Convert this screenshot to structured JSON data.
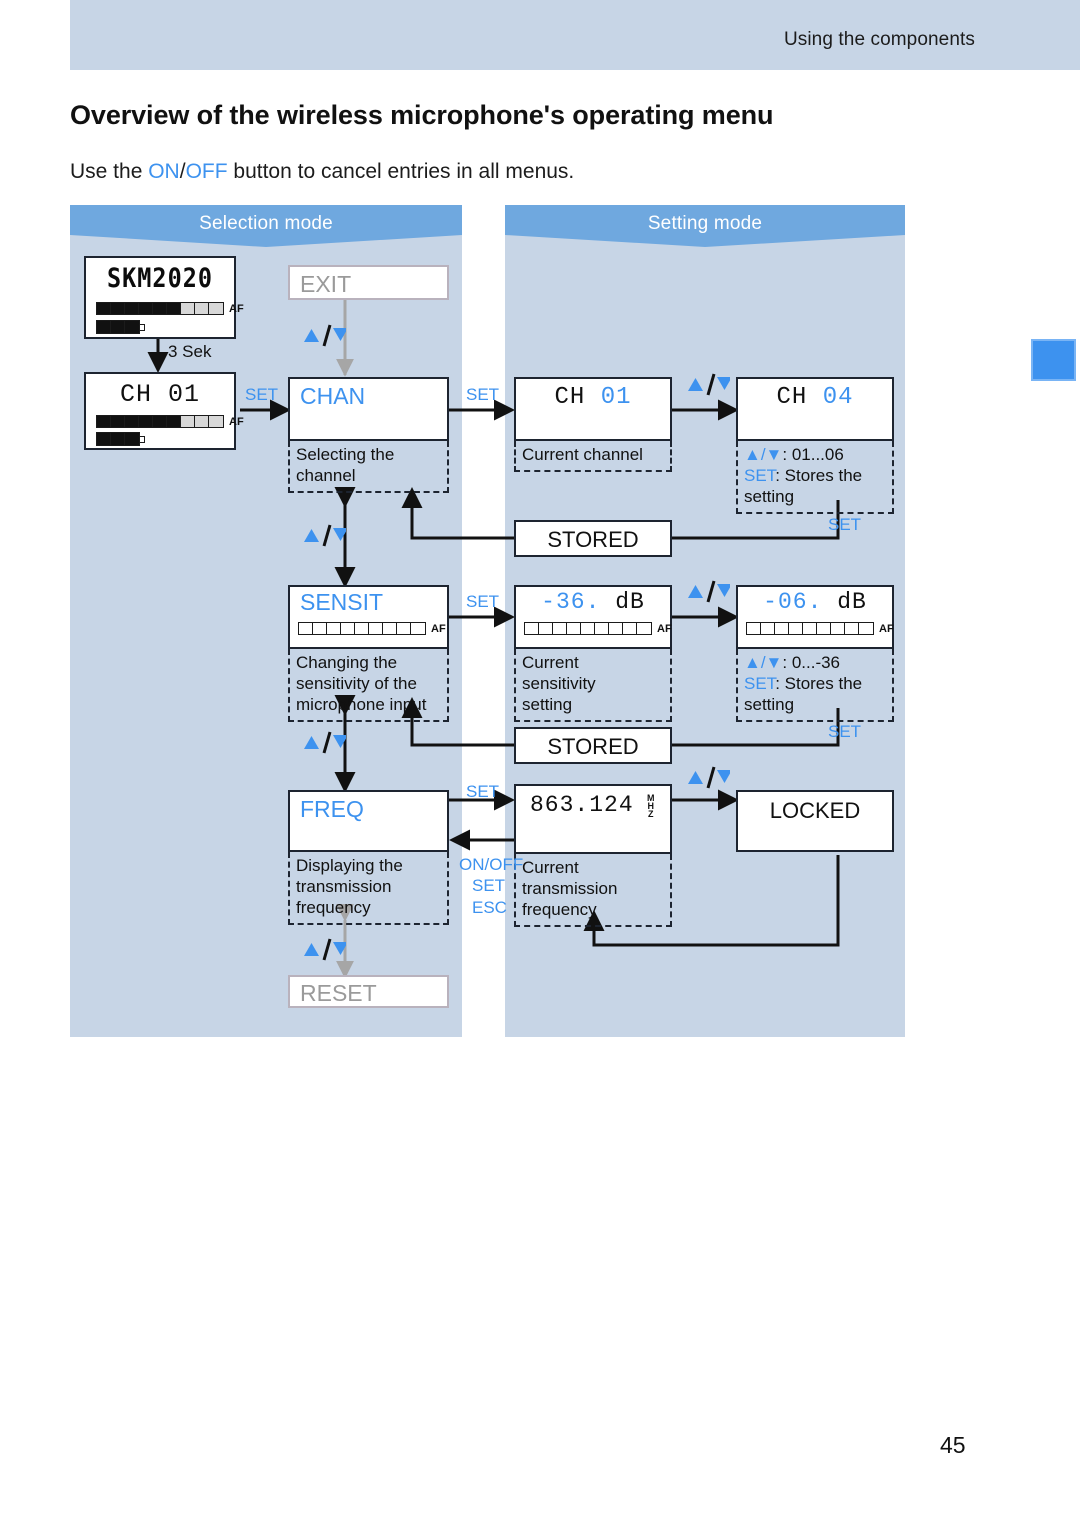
{
  "header": {
    "running_head": "Using the components"
  },
  "title": "Overview of the wireless microphone's operating menu",
  "intro": {
    "pre": "Use the ",
    "on": "ON",
    "slash": "/",
    "off": "OFF",
    "post": " button to cancel entries in all menus."
  },
  "page_number": "45",
  "panels": {
    "selection": {
      "label": "Selection mode"
    },
    "setting": {
      "label": "Setting mode"
    }
  },
  "nodes": {
    "splash": {
      "display": "SKM2020"
    },
    "home": {
      "display": "CH 01"
    },
    "exit": {
      "label": "EXIT"
    },
    "reset": {
      "label": "RESET"
    },
    "chan": {
      "label": "CHAN",
      "caption": "Selecting the channel"
    },
    "sensit": {
      "label": "SENSIT",
      "caption_l1": "Changing the",
      "caption_l2": "sensitivity of the",
      "caption_l3": "microphone input"
    },
    "freq": {
      "label": "FREQ",
      "caption_l1": "Displaying the",
      "caption_l2": "transmission",
      "caption_l3": "frequency"
    },
    "chan_current": {
      "prefix": "CH",
      "value": "01",
      "caption": "Current channel"
    },
    "chan_edit": {
      "prefix": "CH",
      "value": "04",
      "caption_key": "▲/▼",
      "caption_range": ": 01...06",
      "caption_set": "SET",
      "caption_set_txt": ": Stores the setting"
    },
    "sens_current": {
      "value": "-36.",
      "unit": "dB",
      "caption_l1": "Current",
      "caption_l2": "sensitivity",
      "caption_l3": "setting"
    },
    "sens_edit": {
      "value": "-06.",
      "unit": "dB",
      "caption_key": "▲/▼",
      "caption_range": ": 0...-36",
      "caption_set": "SET",
      "caption_set_txt": ": Stores the setting"
    },
    "freq_current": {
      "value": "863.124",
      "unit_m": "M",
      "unit_h": "H",
      "unit_z": "Z",
      "caption_l1": "Current",
      "caption_l2": "transmission",
      "caption_l3": "frequency"
    },
    "locked": {
      "label": "LOCKED"
    },
    "stored_1": {
      "label": "STORED"
    },
    "stored_2": {
      "label": "STORED"
    }
  },
  "keys": {
    "hold": "3 Sek",
    "set_1": "SET",
    "set_2": "SET",
    "set_3": "SET",
    "set_4": "SET",
    "set_5": "SET",
    "set_6": "SET",
    "set_7": "SET",
    "onoff": "ON/OFF",
    "set_esc_set": "SET",
    "esc": "ESC"
  },
  "colors": {
    "accent": "#3d92ef",
    "panel": "#c7d5e6",
    "panel_head": "#6fa8df",
    "band": "#c7d5e6",
    "ink": "#1d2430"
  }
}
